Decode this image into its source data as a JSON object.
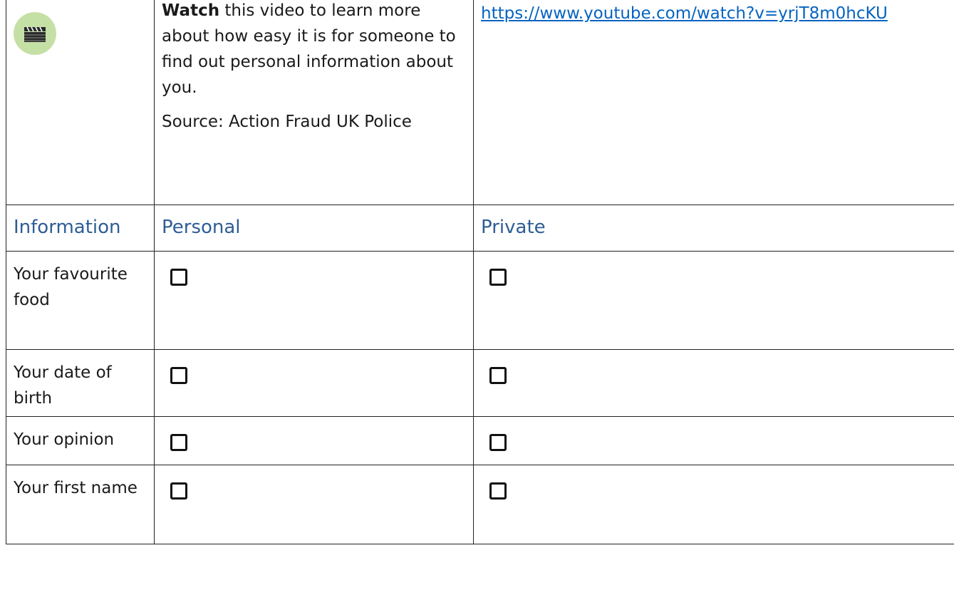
{
  "video": {
    "icon": "clapperboard-icon",
    "lead_bold": "Watch",
    "lead_rest": " this video to learn more about how easy it is for someone to find out personal information about you.",
    "source": "Source: Action Fraud UK Police",
    "link_text": "https://www.youtube.com/watch?v=yrjT8m0hcKU"
  },
  "columns": [
    "Information",
    "Personal",
    "Private"
  ],
  "rows": [
    {
      "label": "Your favourite food"
    },
    {
      "label": "Your date of birth"
    },
    {
      "label": "Your opinion"
    },
    {
      "label": "Your first name"
    }
  ],
  "colors": {
    "heading": "#2e5d96",
    "link": "#0563c1",
    "icon_bg": "#c5e0a5"
  }
}
